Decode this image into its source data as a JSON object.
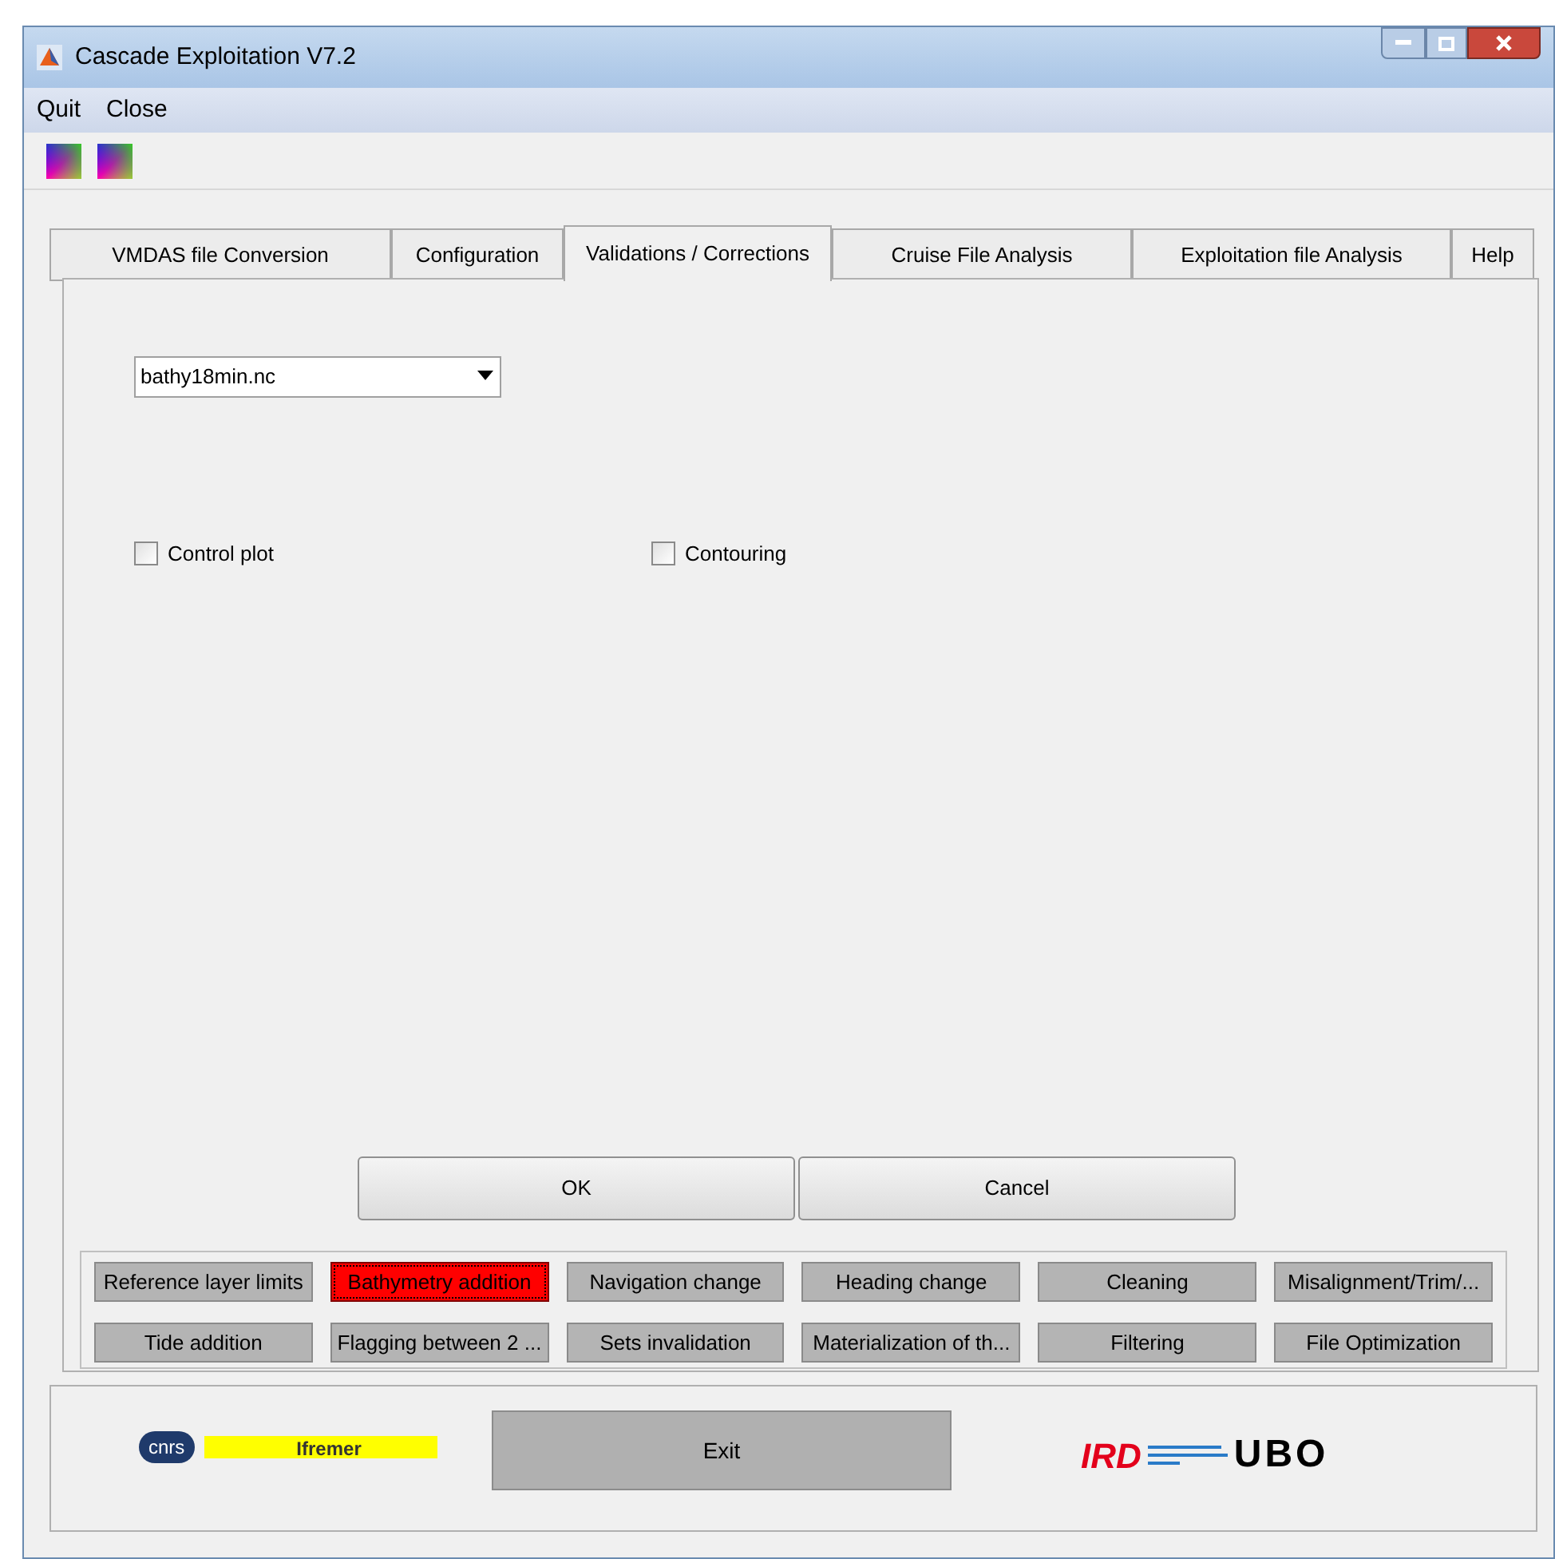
{
  "window": {
    "title": "Cascade Exploitation V7.2"
  },
  "menu": [
    "Quit",
    "Close"
  ],
  "tabs": [
    {
      "label": "VMDAS file Conversion",
      "selected": false
    },
    {
      "label": "Configuration",
      "selected": false
    },
    {
      "label": "Validations / Corrections",
      "selected": true
    },
    {
      "label": "Cruise File Analysis",
      "selected": false
    },
    {
      "label": "Exploitation file Analysis",
      "selected": false
    },
    {
      "label": "Help",
      "selected": false
    }
  ],
  "file_select": {
    "value": "bathy18min.nc"
  },
  "checkboxes": [
    {
      "label": "Control plot",
      "checked": false
    },
    {
      "label": "Contouring",
      "checked": false
    }
  ],
  "dialog_buttons": [
    "OK",
    "Cancel"
  ],
  "tool_buttons": [
    {
      "label": "Reference layer limits",
      "selected": false
    },
    {
      "label": "Bathymetry addition",
      "selected": true
    },
    {
      "label": "Navigation change",
      "selected": false
    },
    {
      "label": "Heading change",
      "selected": false
    },
    {
      "label": "Cleaning",
      "selected": false
    },
    {
      "label": "Misalignment/Trim/...",
      "selected": false
    },
    {
      "label": "Tide addition",
      "selected": false
    },
    {
      "label": "Flagging between 2 ...",
      "selected": false
    },
    {
      "label": "Sets invalidation",
      "selected": false
    },
    {
      "label": "Materialization of th...",
      "selected": false
    },
    {
      "label": "Filtering",
      "selected": false
    },
    {
      "label": "File Optimization",
      "selected": false
    }
  ],
  "footer": {
    "logos_left": [
      "cnrs",
      "Ifremer"
    ],
    "exit_button": "Exit",
    "logos_right": [
      "IRD",
      "UBO"
    ]
  }
}
